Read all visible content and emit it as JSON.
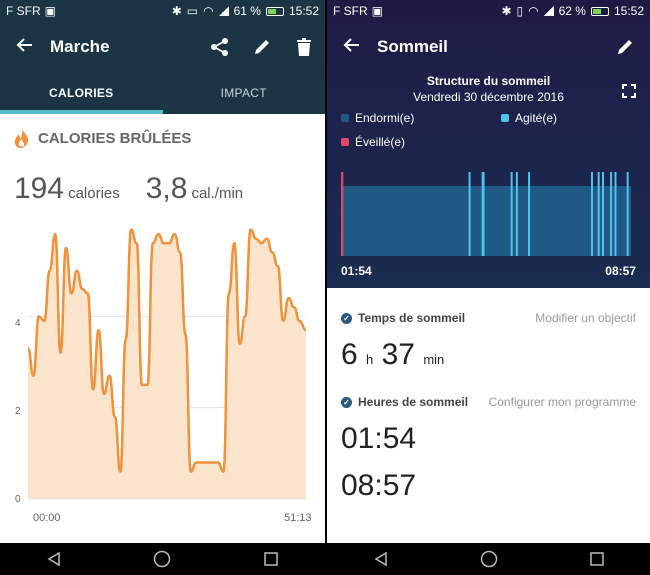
{
  "left": {
    "status": {
      "carrier": "F SFR",
      "battery": "61 %",
      "time": "15:52",
      "battery_fill": 0.61
    },
    "appbar": {
      "title": "Marche",
      "icons": [
        "back-arrow-icon",
        "share-icon",
        "edit-icon",
        "delete-icon"
      ]
    },
    "tabs": [
      {
        "label": "CALORIES",
        "active": true
      },
      {
        "label": "IMPACT",
        "active": false
      }
    ],
    "section": {
      "title": "CALORIES BRÛLÉES",
      "icon": "flame-icon",
      "icon_color": "#f0913b"
    },
    "metrics": {
      "calories_value": "194",
      "calories_unit": "calories",
      "rate_value": "3,8",
      "rate_unit": "cal./min"
    },
    "chart_data": {
      "type": "area",
      "color": "#f0913b",
      "fill_color": "#fbe4cc",
      "y_ticks": [
        "0",
        "2",
        "4"
      ],
      "ylim": [
        0,
        6
      ],
      "x_ticks": [
        "00:00",
        "51:13"
      ],
      "x_minutes": [
        0,
        1,
        2,
        3,
        4,
        5,
        6,
        7,
        8,
        9,
        10,
        11,
        12,
        13,
        14,
        15,
        16,
        17,
        18,
        19,
        20,
        21,
        22,
        23,
        24,
        25,
        26,
        27,
        28,
        29,
        30,
        31,
        32,
        33,
        34,
        35,
        36,
        37,
        38,
        39,
        40,
        41,
        42,
        43,
        44,
        45,
        46,
        47,
        48,
        49,
        50,
        51.2
      ],
      "values": [
        3.3,
        2.7,
        4.0,
        3.9,
        5.0,
        5.8,
        3.2,
        5.5,
        4.5,
        5.0,
        4.6,
        4.5,
        2.4,
        3.7,
        2.3,
        2.7,
        1.8,
        0.6,
        3.5,
        5.9,
        5.6,
        2.5,
        2.5,
        5.6,
        5.8,
        5.6,
        5.6,
        5.8,
        5.4,
        3.6,
        0.6,
        0.8,
        0.8,
        0.8,
        0.8,
        0.8,
        0.6,
        4.5,
        5.6,
        3.4,
        4.0,
        5.9,
        5.7,
        5.6,
        5.7,
        5.4,
        5.1,
        3.9,
        4.4,
        4.2,
        3.9,
        3.7
      ],
      "grid": true
    }
  },
  "right": {
    "status": {
      "carrier": "F SFR",
      "battery": "62 %",
      "time": "15:52",
      "battery_fill": 0.62
    },
    "appbar": {
      "title": "Sommeil",
      "icons": [
        "back-arrow-icon",
        "edit-icon"
      ]
    },
    "chart_title": "Structure du sommeil",
    "chart_date": "Vendredi 30 décembre 2016",
    "legend": [
      {
        "label": "Endormi(e)",
        "color": "#1e5a84"
      },
      {
        "label": "Agité(e)",
        "color": "#4fc3f0"
      },
      {
        "label": "Éveillé(e)",
        "color": "#e0466a"
      }
    ],
    "chart_data": {
      "type": "bar",
      "x_ticks": [
        "01:54",
        "08:57"
      ],
      "base_state": "Endormi(e)",
      "events": [
        {
          "state": "Éveillé(e)",
          "start_frac": 0.0,
          "width_frac": 0.008
        },
        {
          "state": "Agité(e)",
          "start_frac": 0.44,
          "width_frac": 0.006
        },
        {
          "state": "Agité(e)",
          "start_frac": 0.485,
          "width_frac": 0.01
        },
        {
          "state": "Agité(e)",
          "start_frac": 0.585,
          "width_frac": 0.006
        },
        {
          "state": "Agité(e)",
          "start_frac": 0.603,
          "width_frac": 0.004
        },
        {
          "state": "Agité(e)",
          "start_frac": 0.645,
          "width_frac": 0.004
        },
        {
          "state": "Agité(e)",
          "start_frac": 0.862,
          "width_frac": 0.004
        },
        {
          "state": "Agité(e)",
          "start_frac": 0.885,
          "width_frac": 0.006
        },
        {
          "state": "Agité(e)",
          "start_frac": 0.9,
          "width_frac": 0.004
        },
        {
          "state": "Agité(e)",
          "start_frac": 0.928,
          "width_frac": 0.004
        },
        {
          "state": "Agité(e)",
          "start_frac": 0.943,
          "width_frac": 0.006
        },
        {
          "state": "Agité(e)",
          "start_frac": 0.985,
          "width_frac": 0.006
        }
      ]
    },
    "sleep_time": {
      "label": "Temps de sommeil",
      "link": "Modifier un objectif",
      "hours": "6",
      "h_unit": "h",
      "minutes": "37",
      "min_unit": "min"
    },
    "sleep_hours": {
      "label": "Heures de sommeil",
      "link": "Configurer mon programme",
      "start": "01:54",
      "end": "08:57"
    }
  }
}
